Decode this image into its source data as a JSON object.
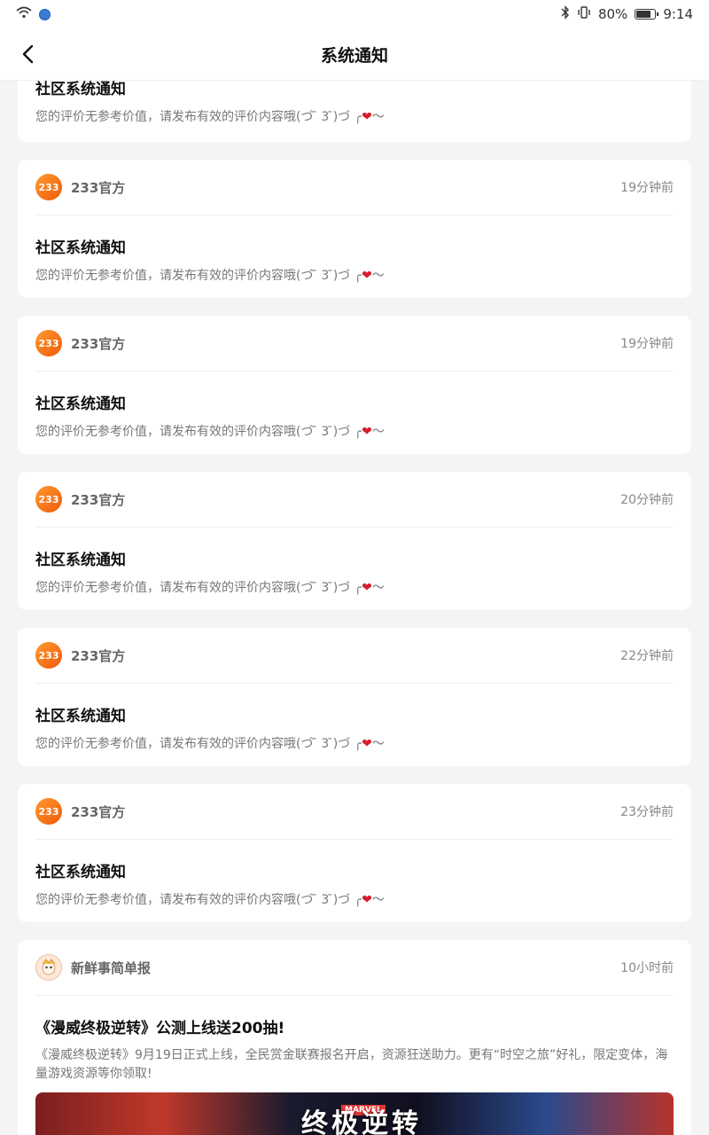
{
  "status_bar": {
    "battery_percent": "80%",
    "battery_level": 0.8,
    "time": "9:14"
  },
  "header": {
    "title": "系统通知"
  },
  "partial_top": {
    "title": "社区系统通知",
    "body_prefix": "您的评价无参考价值，请发布有效的评价内容哦(づ ̄ 3 ̄)づ ╭",
    "heart": "❤",
    "tilde": "～"
  },
  "notifications": [
    {
      "sender": "233官方",
      "time": "19分钟前",
      "title": "社区系统通知",
      "body_prefix": "您的评价无参考价值，请发布有效的评价内容哦(づ ̄ 3 ̄)づ ╭",
      "heart": "❤",
      "tilde": "～",
      "avatar_text": "233"
    },
    {
      "sender": "233官方",
      "time": "19分钟前",
      "title": "社区系统通知",
      "body_prefix": "您的评价无参考价值，请发布有效的评价内容哦(づ ̄ 3 ̄)づ ╭",
      "heart": "❤",
      "tilde": "～",
      "avatar_text": "233"
    },
    {
      "sender": "233官方",
      "time": "20分钟前",
      "title": "社区系统通知",
      "body_prefix": "您的评价无参考价值，请发布有效的评价内容哦(づ ̄ 3 ̄)づ ╭",
      "heart": "❤",
      "tilde": "～",
      "avatar_text": "233"
    },
    {
      "sender": "233官方",
      "time": "22分钟前",
      "title": "社区系统通知",
      "body_prefix": "您的评价无参考价值，请发布有效的评价内容哦(づ ̄ 3 ̄)づ ╭",
      "heart": "❤",
      "tilde": "～",
      "avatar_text": "233"
    },
    {
      "sender": "233官方",
      "time": "23分钟前",
      "title": "社区系统通知",
      "body_prefix": "您的评价无参考价值，请发布有效的评价内容哦(づ ̄ 3 ̄)づ ╭",
      "heart": "❤",
      "tilde": "～",
      "avatar_text": "233"
    }
  ],
  "news": {
    "sender": "新鲜事简单报",
    "time": "10小时前",
    "title": "《漫威终极逆转》公测上线送200抽!",
    "body": "《漫威终极逆转》9月19日正式上线，全民赏金联赛报名开启，资源狂送助力。更有“时空之旅”好礼，限定变体，海量游戏资源等你领取!",
    "banner_logo": "终极逆转",
    "banner_tag": "MARVEL"
  },
  "colors": {
    "accent_orange": "#f57a1c",
    "heart_red": "#d61f2b",
    "background": "#f4f4f4"
  }
}
